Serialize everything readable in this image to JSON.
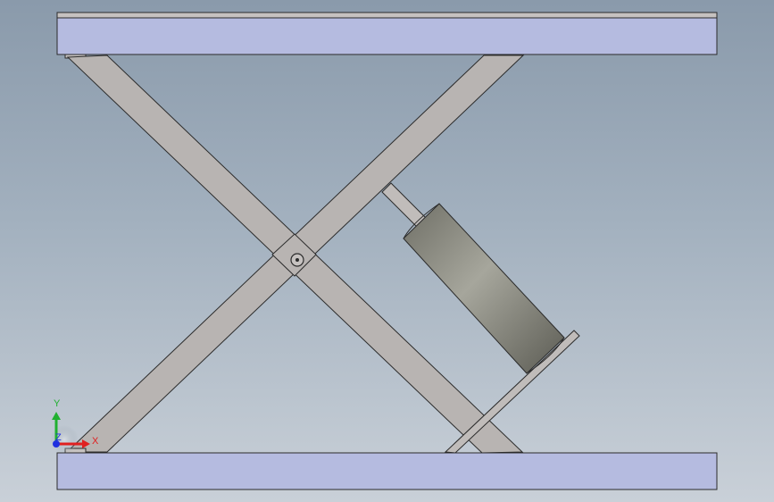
{
  "viewport": {
    "background_top": "#8a9aab",
    "background_bottom": "#c9d0d8"
  },
  "model": {
    "platform_color": "#b5bbe0",
    "arm_color": "#b8b4b2",
    "cylinder_color": "#8e8e82",
    "edge_color": "#2b2b2b"
  },
  "triad": {
    "x_label": "X",
    "y_label": "Y",
    "z_label": "Z",
    "x_color": "#e02020",
    "y_color": "#20b030",
    "z_color": "#2030e0"
  }
}
